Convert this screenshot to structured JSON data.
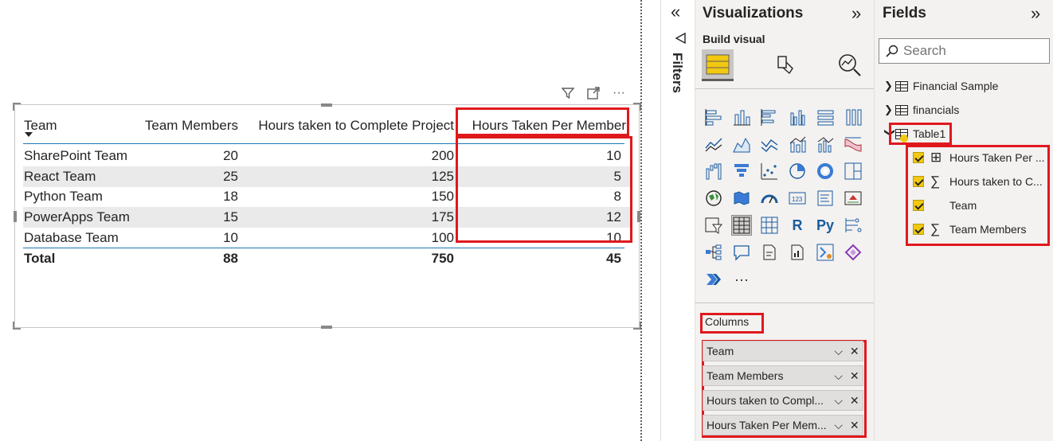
{
  "visual_header": {
    "icons": [
      "filter-icon",
      "focus-mode-icon",
      "more-options-icon"
    ],
    "more_glyph": "···"
  },
  "table": {
    "columns": [
      "Team",
      "Team Members",
      "Hours taken to Complete Project",
      "Hours Taken Per Member"
    ],
    "rows": [
      [
        "SharePoint Team",
        "20",
        "200",
        "10"
      ],
      [
        "React Team",
        "25",
        "125",
        "5"
      ],
      [
        "Python Team",
        "18",
        "150",
        "8"
      ],
      [
        "PowerApps Team",
        "15",
        "175",
        "12"
      ],
      [
        "Database Team",
        "10",
        "100",
        "10"
      ]
    ],
    "total": [
      "Total",
      "88",
      "750",
      "45"
    ]
  },
  "filters": {
    "label": "Filters",
    "collapse_glyph": "«"
  },
  "visualizations": {
    "title": "Visualizations",
    "collapse_glyph": "»",
    "build_visual": "Build visual",
    "more_glyph": "···",
    "columns_label": "Columns",
    "wells": [
      "Team",
      "Team Members",
      "Hours taken to Compl...",
      "Hours Taken Per Mem..."
    ],
    "visual_icons": [
      "R",
      "Py"
    ]
  },
  "fields": {
    "title": "Fields",
    "collapse_glyph": "»",
    "search_placeholder": "Search",
    "tables": [
      "Financial Sample",
      "financials",
      "Table1"
    ],
    "table1_fields": [
      "Hours Taken Per ...",
      "Hours taken to C...",
      "Team",
      "Team Members"
    ]
  },
  "colors": {
    "highlight": "#e0181e",
    "accent_yellow": "#f2c811",
    "pane_bg": "#f3f2f1",
    "row_shade": "#eaeaea",
    "rule_blue": "#1f78b4"
  }
}
